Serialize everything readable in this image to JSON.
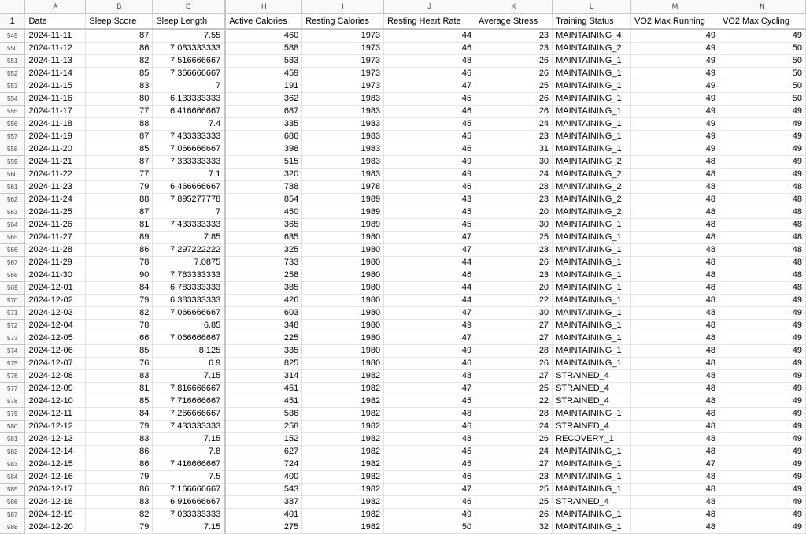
{
  "column_letters": [
    "A",
    "B",
    "C",
    "H",
    "I",
    "J",
    "K",
    "L",
    "M",
    "N"
  ],
  "header_row_number": "1",
  "headers": [
    "Date",
    "Sleep Score",
    "Sleep Length",
    "Active Calories",
    "Resting Calories",
    "Resting Heart Rate",
    "Average Stress",
    "Training Status",
    "VO2 Max Running",
    "VO2 Max Cycling"
  ],
  "rows": [
    {
      "n": "549",
      "c": [
        "2024-11-11",
        "87",
        "7.55",
        "460",
        "1973",
        "44",
        "23",
        "MAINTAINING_4",
        "49",
        "49"
      ]
    },
    {
      "n": "550",
      "c": [
        "2024-11-12",
        "86",
        "7.083333333",
        "588",
        "1973",
        "46",
        "23",
        "MAINTAINING_2",
        "49",
        "50"
      ]
    },
    {
      "n": "551",
      "c": [
        "2024-11-13",
        "82",
        "7.516666667",
        "583",
        "1973",
        "48",
        "26",
        "MAINTAINING_1",
        "49",
        "50"
      ]
    },
    {
      "n": "552",
      "c": [
        "2024-11-14",
        "85",
        "7.366666667",
        "459",
        "1973",
        "46",
        "26",
        "MAINTAINING_1",
        "49",
        "50"
      ]
    },
    {
      "n": "553",
      "c": [
        "2024-11-15",
        "83",
        "7",
        "191",
        "1973",
        "47",
        "25",
        "MAINTAINING_1",
        "49",
        "50"
      ]
    },
    {
      "n": "554",
      "c": [
        "2024-11-16",
        "80",
        "6.133333333",
        "362",
        "1983",
        "45",
        "26",
        "MAINTAINING_1",
        "49",
        "50"
      ]
    },
    {
      "n": "555",
      "c": [
        "2024-11-17",
        "77",
        "6.416666667",
        "687",
        "1983",
        "46",
        "26",
        "MAINTAINING_1",
        "49",
        "49"
      ]
    },
    {
      "n": "556",
      "c": [
        "2024-11-18",
        "88",
        "7.4",
        "335",
        "1983",
        "45",
        "24",
        "MAINTAINING_1",
        "49",
        "49"
      ]
    },
    {
      "n": "557",
      "c": [
        "2024-11-19",
        "87",
        "7.433333333",
        "686",
        "1983",
        "45",
        "23",
        "MAINTAINING_1",
        "49",
        "49"
      ]
    },
    {
      "n": "558",
      "c": [
        "2024-11-20",
        "85",
        "7.066666667",
        "398",
        "1983",
        "46",
        "31",
        "MAINTAINING_1",
        "49",
        "49"
      ]
    },
    {
      "n": "559",
      "c": [
        "2024-11-21",
        "87",
        "7.333333333",
        "515",
        "1983",
        "49",
        "30",
        "MAINTAINING_2",
        "48",
        "49"
      ]
    },
    {
      "n": "560",
      "c": [
        "2024-11-22",
        "77",
        "7.1",
        "320",
        "1983",
        "49",
        "24",
        "MAINTAINING_2",
        "48",
        "49"
      ]
    },
    {
      "n": "561",
      "c": [
        "2024-11-23",
        "79",
        "6.466666667",
        "788",
        "1978",
        "46",
        "28",
        "MAINTAINING_2",
        "48",
        "48"
      ]
    },
    {
      "n": "562",
      "c": [
        "2024-11-24",
        "88",
        "7.895277778",
        "854",
        "1989",
        "43",
        "23",
        "MAINTAINING_2",
        "48",
        "48"
      ]
    },
    {
      "n": "563",
      "c": [
        "2024-11-25",
        "87",
        "7",
        "450",
        "1989",
        "45",
        "20",
        "MAINTAINING_2",
        "48",
        "48"
      ]
    },
    {
      "n": "564",
      "c": [
        "2024-11-26",
        "81",
        "7.433333333",
        "365",
        "1989",
        "45",
        "30",
        "MAINTAINING_1",
        "48",
        "48"
      ]
    },
    {
      "n": "565",
      "c": [
        "2024-11-27",
        "89",
        "7.85",
        "635",
        "1980",
        "47",
        "25",
        "MAINTAINING_1",
        "48",
        "48"
      ]
    },
    {
      "n": "566",
      "c": [
        "2024-11-28",
        "86",
        "7.297222222",
        "325",
        "1980",
        "47",
        "23",
        "MAINTAINING_1",
        "48",
        "48"
      ]
    },
    {
      "n": "567",
      "c": [
        "2024-11-29",
        "78",
        "7.0875",
        "733",
        "1980",
        "44",
        "26",
        "MAINTAINING_1",
        "48",
        "48"
      ]
    },
    {
      "n": "568",
      "c": [
        "2024-11-30",
        "90",
        "7.783333333",
        "258",
        "1980",
        "46",
        "23",
        "MAINTAINING_1",
        "48",
        "48"
      ]
    },
    {
      "n": "569",
      "c": [
        "2024-12-01",
        "84",
        "6.783333333",
        "385",
        "1980",
        "44",
        "20",
        "MAINTAINING_1",
        "48",
        "48"
      ]
    },
    {
      "n": "570",
      "c": [
        "2024-12-02",
        "79",
        "6.383333333",
        "426",
        "1980",
        "44",
        "22",
        "MAINTAINING_1",
        "48",
        "49"
      ]
    },
    {
      "n": "571",
      "c": [
        "2024-12-03",
        "82",
        "7.066666667",
        "603",
        "1980",
        "47",
        "30",
        "MAINTAINING_1",
        "48",
        "49"
      ]
    },
    {
      "n": "572",
      "c": [
        "2024-12-04",
        "78",
        "6.85",
        "348",
        "1980",
        "49",
        "27",
        "MAINTAINING_1",
        "48",
        "49"
      ]
    },
    {
      "n": "573",
      "c": [
        "2024-12-05",
        "66",
        "7.066666667",
        "225",
        "1980",
        "47",
        "27",
        "MAINTAINING_1",
        "48",
        "49"
      ]
    },
    {
      "n": "574",
      "c": [
        "2024-12-06",
        "85",
        "8.125",
        "335",
        "1980",
        "49",
        "28",
        "MAINTAINING_1",
        "48",
        "49"
      ]
    },
    {
      "n": "575",
      "c": [
        "2024-12-07",
        "76",
        "6.9",
        "825",
        "1980",
        "46",
        "26",
        "MAINTAINING_1",
        "48",
        "49"
      ]
    },
    {
      "n": "576",
      "c": [
        "2024-12-08",
        "83",
        "7.15",
        "314",
        "1982",
        "48",
        "27",
        "STRAINED_4",
        "48",
        "49"
      ]
    },
    {
      "n": "577",
      "c": [
        "2024-12-09",
        "81",
        "7.816666667",
        "451",
        "1982",
        "47",
        "25",
        "STRAINED_4",
        "48",
        "49"
      ]
    },
    {
      "n": "578",
      "c": [
        "2024-12-10",
        "85",
        "7.716666667",
        "451",
        "1982",
        "45",
        "22",
        "STRAINED_4",
        "48",
        "49"
      ]
    },
    {
      "n": "579",
      "c": [
        "2024-12-11",
        "84",
        "7.266666667",
        "536",
        "1982",
        "48",
        "28",
        "MAINTAINING_1",
        "48",
        "49"
      ]
    },
    {
      "n": "580",
      "c": [
        "2024-12-12",
        "79",
        "7.433333333",
        "258",
        "1982",
        "46",
        "24",
        "STRAINED_4",
        "48",
        "49"
      ]
    },
    {
      "n": "581",
      "c": [
        "2024-12-13",
        "83",
        "7.15",
        "152",
        "1982",
        "48",
        "26",
        "RECOVERY_1",
        "48",
        "49"
      ]
    },
    {
      "n": "582",
      "c": [
        "2024-12-14",
        "86",
        "7.8",
        "627",
        "1982",
        "45",
        "24",
        "MAINTAINING_1",
        "48",
        "49"
      ]
    },
    {
      "n": "583",
      "c": [
        "2024-12-15",
        "86",
        "7.416666667",
        "724",
        "1982",
        "45",
        "27",
        "MAINTAINING_1",
        "47",
        "49"
      ]
    },
    {
      "n": "584",
      "c": [
        "2024-12-16",
        "79",
        "7.5",
        "400",
        "1982",
        "46",
        "23",
        "MAINTAINING_1",
        "48",
        "49"
      ]
    },
    {
      "n": "585",
      "c": [
        "2024-12-17",
        "86",
        "7.166666667",
        "543",
        "1982",
        "47",
        "25",
        "MAINTAINING_1",
        "48",
        "49"
      ]
    },
    {
      "n": "586",
      "c": [
        "2024-12-18",
        "83",
        "6.916666667",
        "387",
        "1982",
        "46",
        "25",
        "STRAINED_4",
        "48",
        "49"
      ]
    },
    {
      "n": "587",
      "c": [
        "2024-12-19",
        "82",
        "7.033333333",
        "401",
        "1982",
        "49",
        "26",
        "MAINTAINING_1",
        "48",
        "49"
      ]
    },
    {
      "n": "588",
      "c": [
        "2024-12-20",
        "79",
        "7.15",
        "275",
        "1982",
        "50",
        "32",
        "MAINTAINING_1",
        "48",
        "49"
      ]
    }
  ]
}
